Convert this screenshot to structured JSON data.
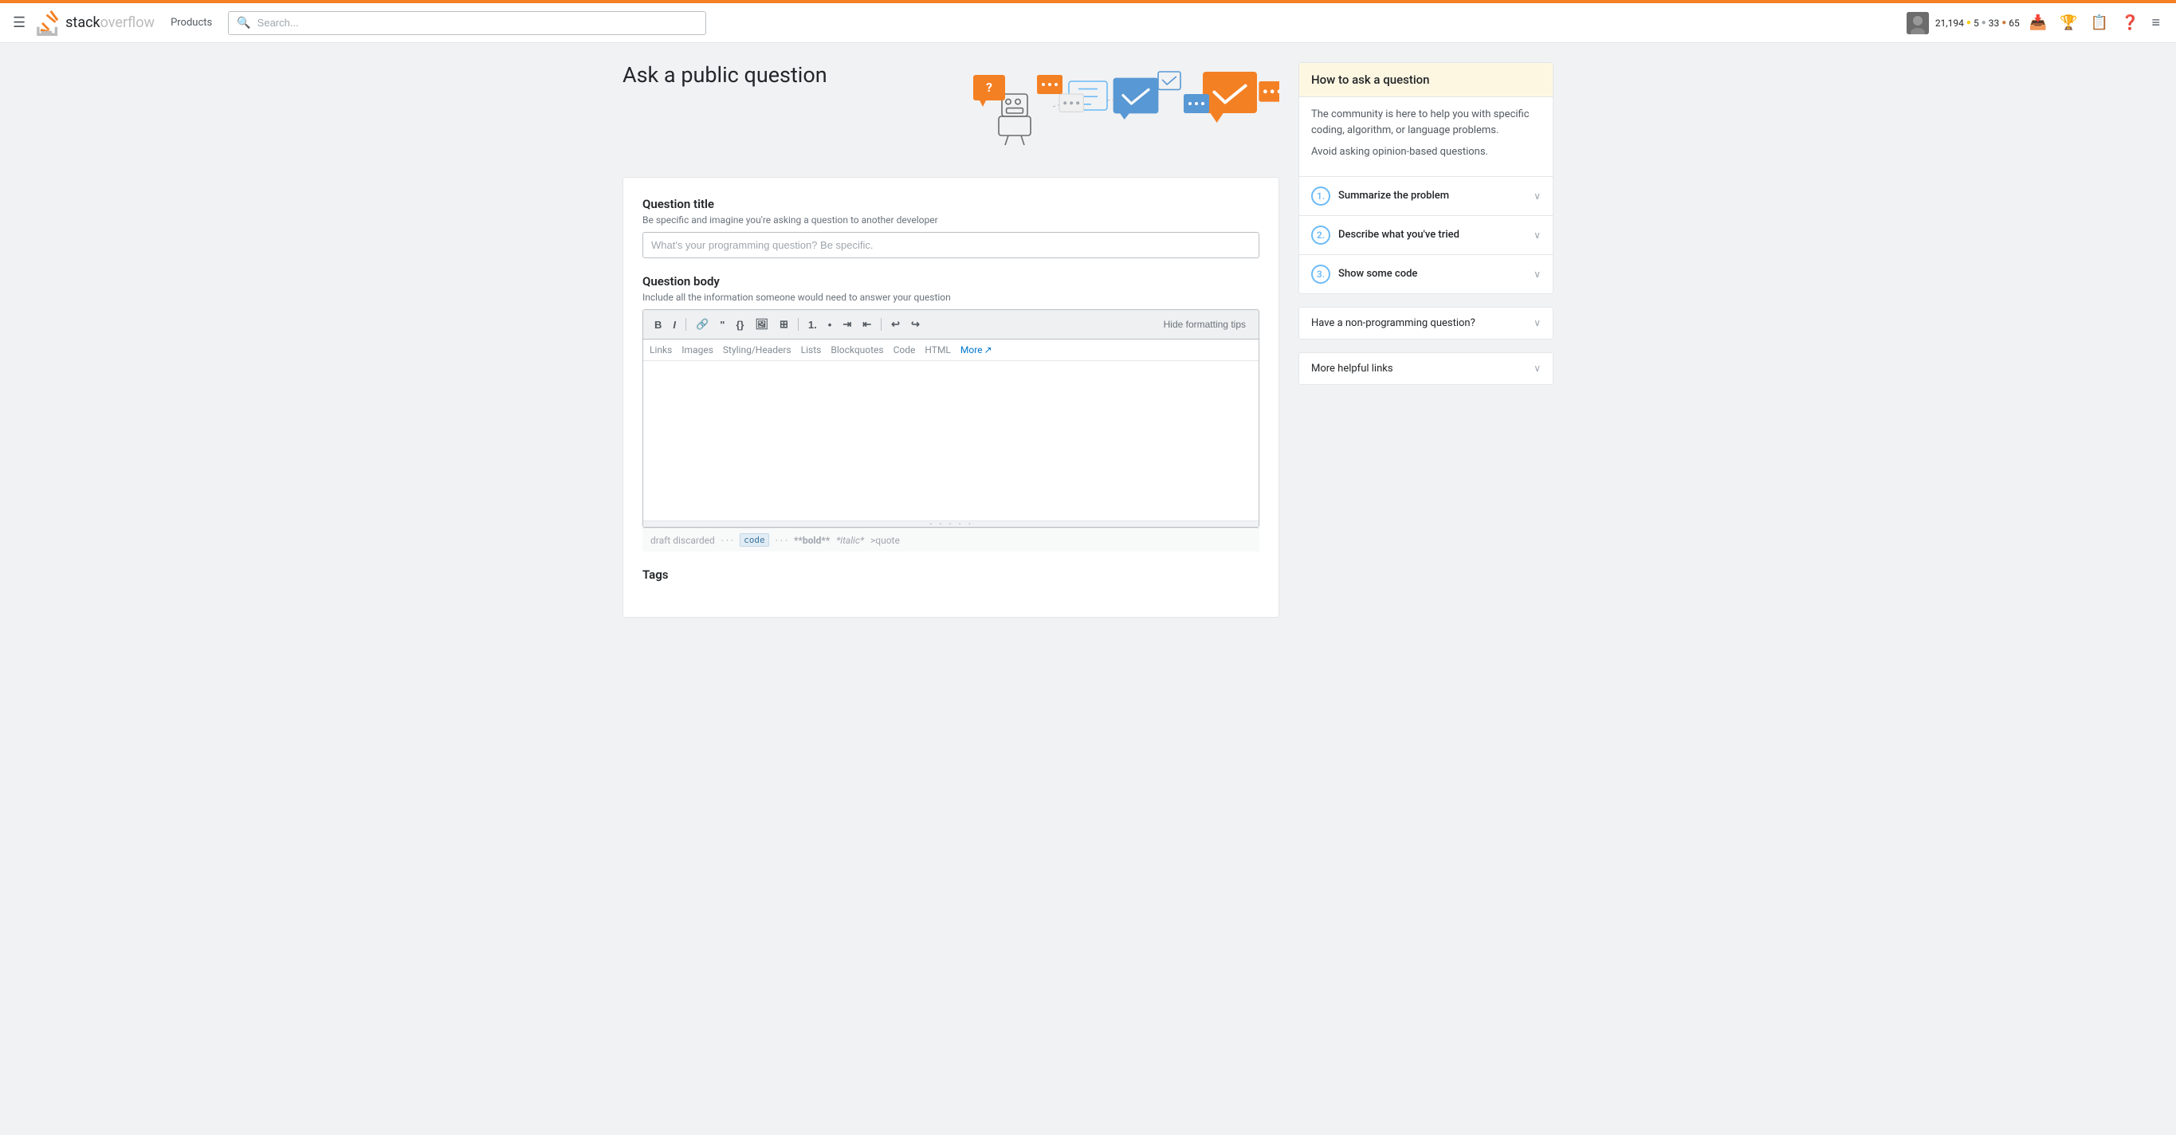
{
  "topstrip": {
    "color": "#f48024"
  },
  "navbar": {
    "logo_text": "stack",
    "logo_text_accent": "overflow",
    "products_label": "Products",
    "search_placeholder": "Search...",
    "reputation": "21,194",
    "gold_count": "5",
    "silver_count": "33",
    "bronze_count": "65"
  },
  "page": {
    "title": "Ask a public question"
  },
  "form": {
    "question_title_label": "Question title",
    "question_title_hint": "Be specific and imagine you're asking a question to another developer",
    "question_title_placeholder": "What's your programming question? Be specific.",
    "question_body_label": "Question body",
    "question_body_hint": "Include all the information someone would need to answer your question",
    "hide_tips_button": "Hide formatting tips",
    "format_tabs": [
      "Links",
      "Images",
      "Styling/Headers",
      "Lists",
      "Blockquotes",
      "Code",
      "HTML"
    ],
    "format_more": "More",
    "draft_status": "draft discarded",
    "code_hint": "code",
    "bold_hint": "**bold**",
    "italic_hint": "*italic*",
    "quote_hint": ">quote",
    "tags_label": "Tags"
  },
  "sidebar": {
    "how_to_title": "How to ask a question",
    "how_to_body1": "The community is here to help you with specific coding, algorithm, or language problems.",
    "how_to_body2": "Avoid asking opinion-based questions.",
    "steps": [
      {
        "number": "1",
        "label": "Summarize the problem"
      },
      {
        "number": "2",
        "label": "Describe what you've tried"
      },
      {
        "number": "3",
        "label": "Show some code"
      }
    ],
    "non_programming_title": "Have a non-programming question?",
    "more_links_title": "More helpful links"
  }
}
